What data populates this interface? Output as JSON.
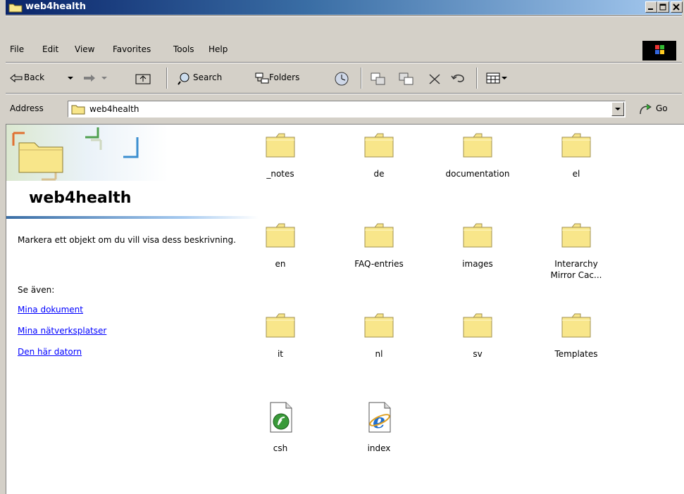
{
  "window": {
    "title": "web4health"
  },
  "menu": {
    "items": [
      "File",
      "Edit",
      "View",
      "Favorites",
      "Tools",
      "Help"
    ]
  },
  "toolbar": {
    "back": "Back",
    "search": "Search",
    "folders": "Folders"
  },
  "address": {
    "label": "Address",
    "value": "web4health",
    "go": "Go"
  },
  "left_pane": {
    "title": "web4health",
    "description": "Markera ett objekt om du vill visa dess beskrivning.",
    "see_also": "Se även:",
    "links": [
      "Mina dokument",
      "Mina nätverksplatser",
      "Den här datorn"
    ]
  },
  "files": [
    {
      "name": "_notes",
      "icon": "folder-icon"
    },
    {
      "name": "de",
      "icon": "folder-icon"
    },
    {
      "name": "documentation",
      "icon": "folder-icon"
    },
    {
      "name": "el",
      "icon": "folder-icon"
    },
    {
      "name": "en",
      "icon": "folder-icon"
    },
    {
      "name": "FAQ-entries",
      "icon": "folder-icon"
    },
    {
      "name": "images",
      "icon": "folder-icon"
    },
    {
      "name": "Interarchy Mirror Cac...",
      "icon": "folder-icon"
    },
    {
      "name": "it",
      "icon": "folder-icon"
    },
    {
      "name": "nl",
      "icon": "folder-icon"
    },
    {
      "name": "sv",
      "icon": "folder-icon"
    },
    {
      "name": "Templates",
      "icon": "folder-icon"
    },
    {
      "name": "csh",
      "icon": "dreamweaver-file-icon"
    },
    {
      "name": "index",
      "icon": "ie-html-file-icon"
    }
  ],
  "colors": {
    "titlebar_start": "#0a246a",
    "titlebar_end": "#a6caf0",
    "chrome": "#d4d0c8",
    "folder": "#f8e68a",
    "link": "#0000ff"
  }
}
